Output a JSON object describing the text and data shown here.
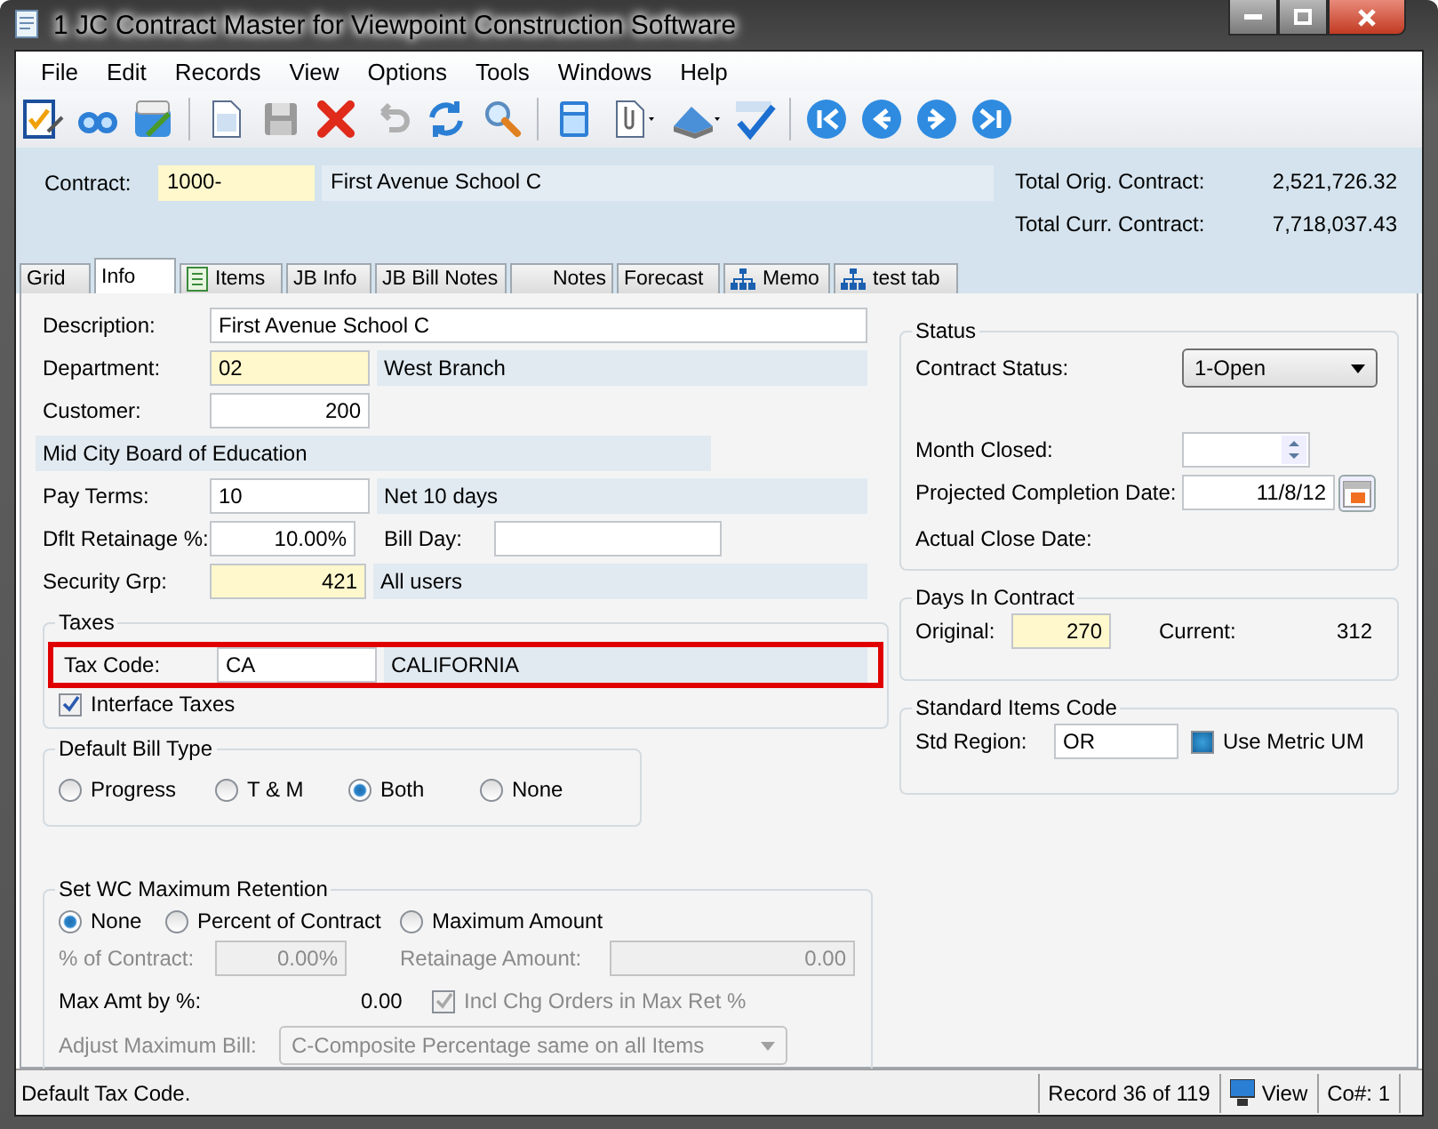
{
  "window": {
    "title": "1 JC Contract Master for Viewpoint Construction Software"
  },
  "menu": [
    "File",
    "Edit",
    "Records",
    "View",
    "Options",
    "Tools",
    "Windows",
    "Help"
  ],
  "header": {
    "contract_label": "Contract:",
    "contract": "1000-",
    "contract_required": true,
    "contract_description": "First Avenue School C",
    "totals": [
      {
        "label": "Total Orig. Contract:",
        "value": "2,521,726.32"
      },
      {
        "label": "Total Curr. Contract:",
        "value": "7,718,037.43"
      }
    ]
  },
  "tabs": [
    {
      "label": "Grid",
      "selected": false,
      "kind": "plain"
    },
    {
      "label": "Info",
      "selected": true,
      "kind": "plain"
    },
    {
      "label": "Items",
      "selected": false,
      "kind": "list"
    },
    {
      "label": "JB Info",
      "selected": false,
      "kind": "plain"
    },
    {
      "label": "JB Bill Notes",
      "selected": false,
      "kind": "plain"
    },
    {
      "label": "Notes",
      "selected": false,
      "kind": "plain"
    },
    {
      "label": "Forecast",
      "selected": false,
      "kind": "plain"
    },
    {
      "label": "Memo",
      "selected": false,
      "kind": "org"
    },
    {
      "label": "test tab",
      "selected": false,
      "kind": "org"
    }
  ],
  "info": {
    "description": {
      "label": "Description:",
      "value": "First Avenue School C"
    },
    "department": {
      "label": "Department:",
      "value": "02",
      "required": true,
      "description": "West Branch"
    },
    "customer": {
      "label": "Customer:",
      "value": "200"
    },
    "customer_name": "Mid City Board of Education",
    "pay_terms": {
      "label": "Pay Terms:",
      "value": "10",
      "description": "Net 10 days"
    },
    "retainage": {
      "label": "Dflt Retainage %:",
      "value": "10.00%"
    },
    "bill_day": {
      "label": "Bill Day:"
    },
    "security_group": {
      "label": "Security Grp:",
      "value": "421",
      "required": true,
      "description": "All users"
    }
  },
  "taxes": {
    "title": "Taxes",
    "tax_code": {
      "label": "Tax Code:",
      "value": "CA",
      "description": "CALIFORNIA",
      "highlighted": true
    },
    "interface_taxes": {
      "label": "Interface Taxes",
      "checked": true
    }
  },
  "bill_type": {
    "title": "Default Bill Type",
    "options": [
      {
        "label": "Progress",
        "selected": false
      },
      {
        "label": "T & M",
        "selected": false
      },
      {
        "label": "Both",
        "selected": true
      },
      {
        "label": "None",
        "selected": false
      }
    ]
  },
  "retention": {
    "title": "Set WC Maximum Retention",
    "options": [
      {
        "label": "None",
        "selected": true
      },
      {
        "label": "Percent of Contract",
        "selected": false
      },
      {
        "label": "Maximum Amount",
        "selected": false
      }
    ],
    "pct_contract": {
      "label": "% of Contract:",
      "value": "0.00%",
      "disabled": true
    },
    "retainage_amount": {
      "label": "Retainage Amount:",
      "value": "0.00",
      "disabled": true
    },
    "max_amt": {
      "label": "Max Amt by %:",
      "value": "0.00"
    },
    "incl_chg": {
      "label": "Incl Chg Orders in Max Ret %",
      "checked": true,
      "disabled": true
    },
    "adjust": {
      "label": "Adjust Maximum Bill:",
      "value": "C-Composite Percentage same on all Items",
      "disabled": true
    }
  },
  "status": {
    "title": "Status",
    "contract_status": {
      "label": "Contract Status:",
      "value": "1-Open"
    },
    "month_closed": {
      "label": "Month Closed:"
    },
    "projected": {
      "label": "Projected Completion Date:",
      "value": "11/8/12"
    },
    "actual_close": {
      "label": "Actual Close Date:"
    }
  },
  "days": {
    "title": "Days In Contract",
    "original": {
      "label": "Original:",
      "value": "270",
      "required": true
    },
    "current": {
      "label": "Current:",
      "value": "312"
    }
  },
  "std_items": {
    "title": "Standard Items Code",
    "region": {
      "label": "Std Region:",
      "value": "OR"
    },
    "metric": {
      "label": "Use Metric UM",
      "checked": false
    }
  },
  "status_bar": {
    "message": "Default Tax Code.",
    "record": "Record 36 of 119",
    "mode": "View",
    "company": "Co#: 1"
  }
}
